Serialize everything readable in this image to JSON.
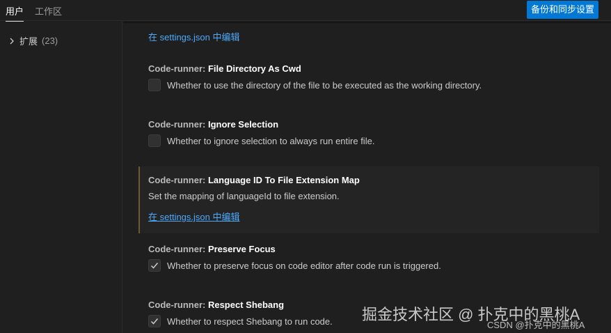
{
  "header": {
    "tabs": [
      {
        "label": "用户",
        "active": true
      },
      {
        "label": "工作区",
        "active": false
      }
    ],
    "backup_button": "备份和同步设置"
  },
  "toc": {
    "items": [
      {
        "label": "扩展",
        "count": "(23)"
      }
    ]
  },
  "main": {
    "prev_link": "在 settings.json 中编辑",
    "settings": [
      {
        "category": "Code-runner: ",
        "name": "File Directory As Cwd",
        "type": "boolean",
        "checked": false,
        "description": "Whether to use the directory of the file to be executed as the working directory."
      },
      {
        "category": "Code-runner: ",
        "name": "Ignore Selection",
        "type": "boolean",
        "checked": false,
        "description": "Whether to ignore selection to always run entire file."
      },
      {
        "category": "Code-runner: ",
        "name": "Language ID To File Extension Map",
        "type": "object",
        "description": "Set the mapping of languageId to file extension.",
        "link": "在 settings.json 中编辑"
      },
      {
        "category": "Code-runner: ",
        "name": "Preserve Focus",
        "type": "boolean",
        "checked": true,
        "description": "Whether to preserve focus on code editor after code run is triggered."
      },
      {
        "category": "Code-runner: ",
        "name": "Respect Shebang",
        "type": "boolean",
        "checked": true,
        "description": "Whether to respect Shebang to run code."
      }
    ]
  },
  "watermark": {
    "primary": "掘金技术社区 @ 扑克中的黑桃A",
    "secondary": "CSDN @扑克中的黑桃A"
  },
  "colors": {
    "background": "#1f1f1f",
    "accent_button": "#0078d4",
    "link": "#4daafc",
    "focus_border": "#6e5a2a"
  }
}
